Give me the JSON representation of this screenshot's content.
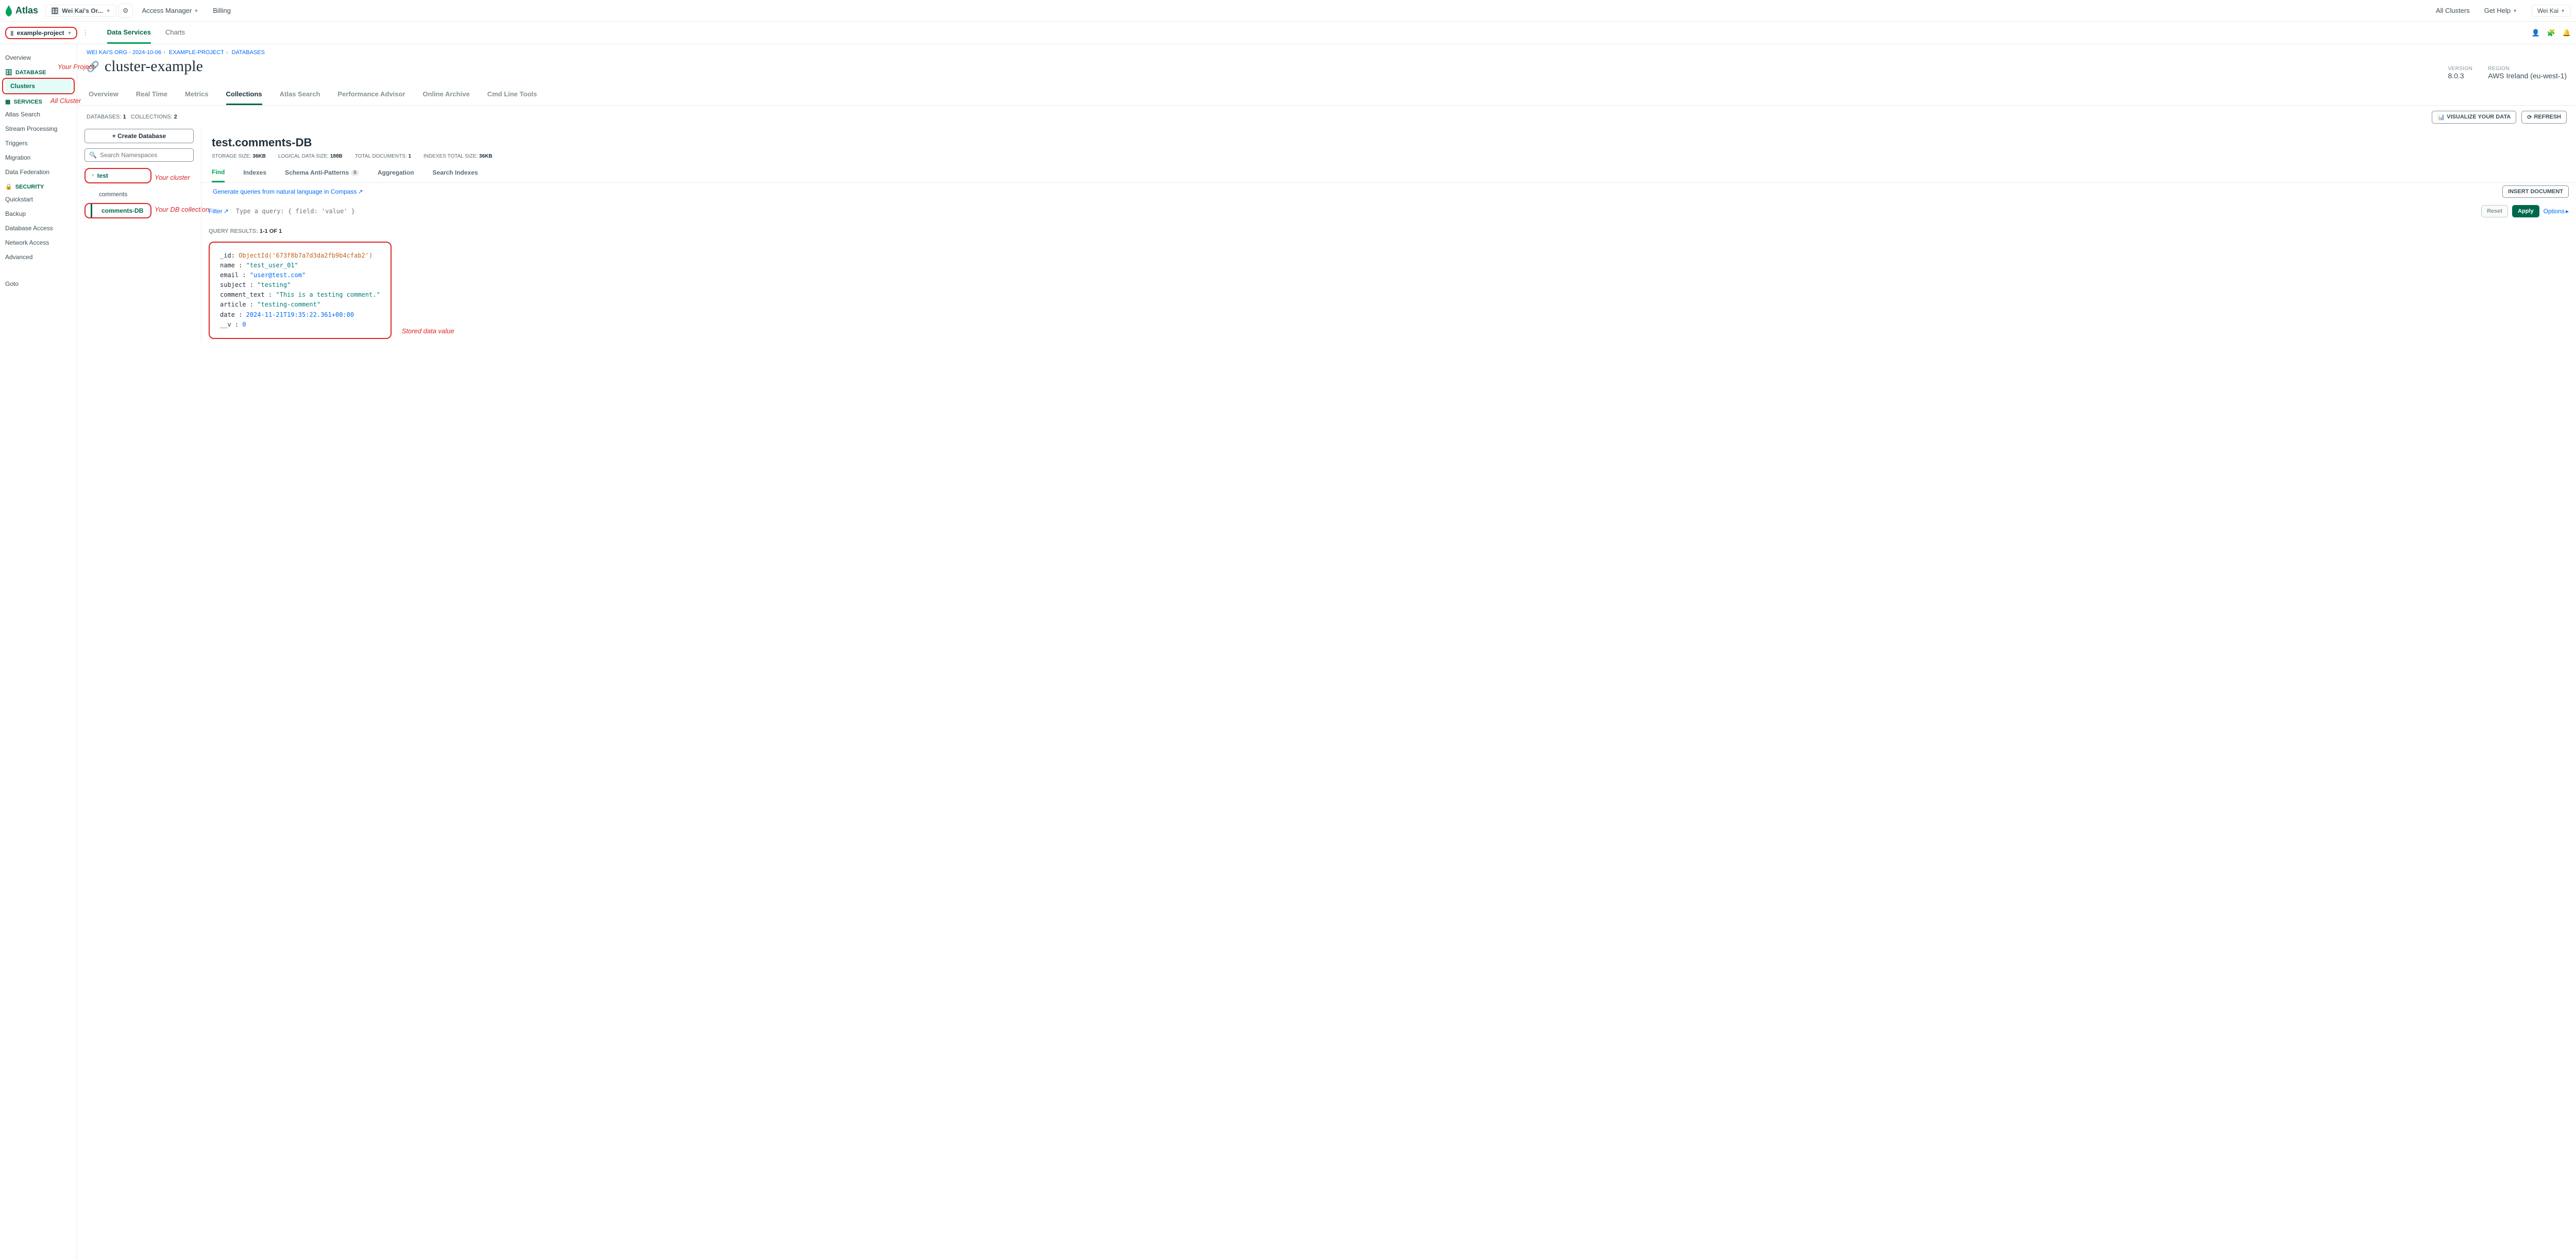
{
  "topbar": {
    "brand": "Atlas",
    "org": "Wei Kai's Or...",
    "access": "Access Manager",
    "billing": "Billing",
    "all_clusters": "All Clusters",
    "get_help": "Get Help",
    "user": "Wei Kai"
  },
  "projbar": {
    "project": "example-project",
    "tabs": {
      "data": "Data Services",
      "charts": "Charts"
    }
  },
  "annotations": {
    "project": "Your Project",
    "all_cluster": "All Cluster",
    "cluster": "Your cluster",
    "collection": "Your DB collection",
    "stored": "Stored data value"
  },
  "leftnav": {
    "overview": "Overview",
    "h_database": "DATABASE",
    "clusters": "Clusters",
    "h_services": "SERVICES",
    "atlas_search": "Atlas Search",
    "stream": "Stream Processing",
    "triggers": "Triggers",
    "migration": "Migration",
    "data_fed": "Data Federation",
    "h_security": "SECURITY",
    "quickstart": "Quickstart",
    "backup": "Backup",
    "db_access": "Database Access",
    "net_access": "Network Access",
    "advanced": "Advanced",
    "goto": "Goto"
  },
  "crumbs": {
    "org": "WEI KAI'S ORG - 2024-10-06",
    "proj": "EXAMPLE-PROJECT",
    "db": "DATABASES"
  },
  "cluster": {
    "name": "cluster-example",
    "version_lbl": "VERSION",
    "version": "8.0.3",
    "region_lbl": "REGION",
    "region": "AWS Ireland (eu-west-1)"
  },
  "ctabs": {
    "overview": "Overview",
    "realtime": "Real Time",
    "metrics": "Metrics",
    "collections": "Collections",
    "search": "Atlas Search",
    "perf": "Performance Advisor",
    "archive": "Online Archive",
    "cmd": "Cmd Line Tools"
  },
  "counts": {
    "dbs_l": "DATABASES:",
    "dbs": "1",
    "cols_l": "COLLECTIONS:",
    "cols": "2",
    "visualize": "VISUALIZE YOUR DATA",
    "refresh": "REFRESH"
  },
  "tree": {
    "create": "+  Create Database",
    "search_ph": "Search Namespaces",
    "db": "test",
    "c1": "comments",
    "c2": "comments-DB"
  },
  "ns": {
    "title": "test.comments-DB",
    "s1l": "STORAGE SIZE:",
    "s1": "36KB",
    "s2l": "LOGICAL DATA SIZE:",
    "s2": "188B",
    "s3l": "TOTAL DOCUMENTS:",
    "s3": "1",
    "s4l": "INDEXES TOTAL SIZE:",
    "s4": "36KB"
  },
  "dtabs": {
    "find": "Find",
    "idx": "Indexes",
    "sap": "Schema Anti-Patterns",
    "agg": "Aggregation",
    "si": "Search Indexes"
  },
  "actions": {
    "genlink": "Generate queries from natural language in Compass",
    "insert": "INSERT DOCUMENT",
    "filter": "Filter",
    "query_ph": "Type a query: { field: 'value' }",
    "reset": "Reset",
    "apply": "Apply",
    "options": "Options"
  },
  "results": {
    "label": "QUERY RESULTS:",
    "range": "1-1 OF 1"
  },
  "doc": {
    "id_k": "_id",
    "id_v": "ObjectId('673f8b7a7d3da2fb9b4cfab2')",
    "name_k": "name",
    "name_v": "\"test_user_01\"",
    "email_k": "email",
    "email_v": "\"user@test.com\"",
    "subject_k": "subject",
    "subject_v": "\"testing\"",
    "ct_k": "comment_text",
    "ct_v": "\"This is a testing comment.\"",
    "art_k": "article",
    "art_v": "\"testing-comment\"",
    "date_k": "date",
    "date_v": "2024-11-21T19:35:22.361+00:00",
    "v_k": "__v",
    "v_v": "0"
  }
}
